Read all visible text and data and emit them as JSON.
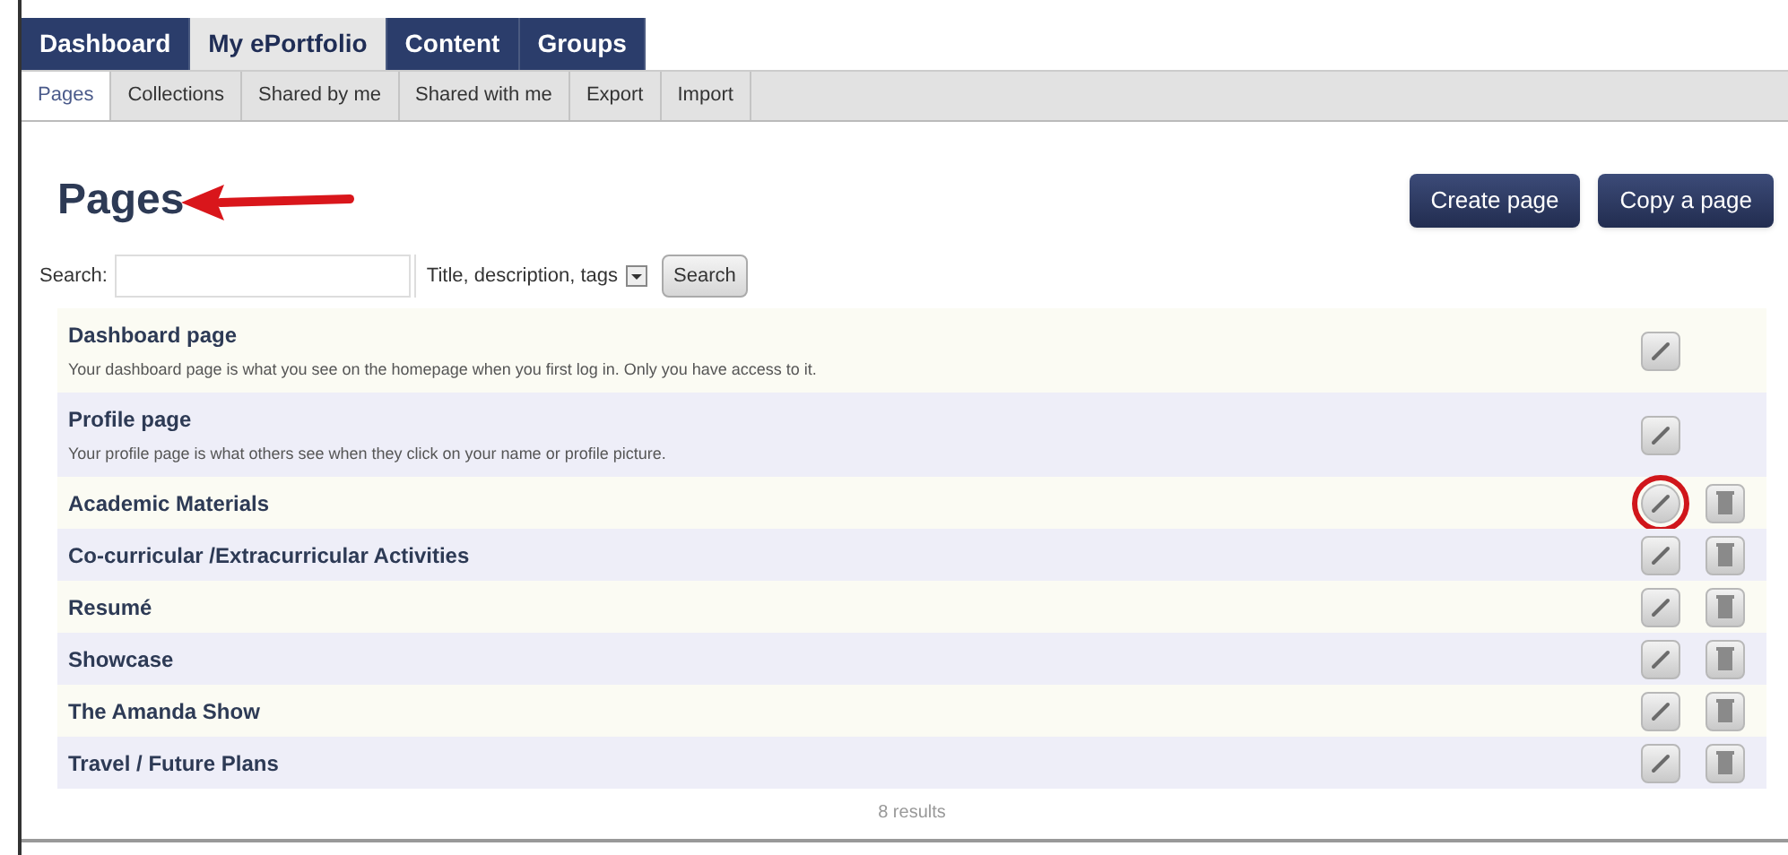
{
  "main_tabs": [
    {
      "label": "Dashboard",
      "selected": false
    },
    {
      "label": "My ePortfolio",
      "selected": true
    },
    {
      "label": "Content",
      "selected": false
    },
    {
      "label": "Groups",
      "selected": false
    }
  ],
  "sub_tabs": [
    {
      "label": "Pages",
      "selected": true
    },
    {
      "label": "Collections",
      "selected": false
    },
    {
      "label": "Shared by me",
      "selected": false
    },
    {
      "label": "Shared with me",
      "selected": false
    },
    {
      "label": "Export",
      "selected": false
    },
    {
      "label": "Import",
      "selected": false
    }
  ],
  "heading": "Pages",
  "buttons": [
    "Create page",
    "Copy a page"
  ],
  "search": {
    "label": "Search:",
    "scope": "Title, description, tags",
    "button": "Search"
  },
  "pages": [
    {
      "kind": "system",
      "title": "Dashboard page",
      "description": "Your dashboard page is what you see on the homepage when you first log in. Only you have access to it.",
      "circled": false
    },
    {
      "kind": "system",
      "title": "Profile page",
      "description": "Your profile page is what others see when they click on your name or profile picture.",
      "circled": false
    },
    {
      "kind": "user",
      "title": "Academic Materials",
      "circled": true
    },
    {
      "kind": "user",
      "title": "Co-curricular /Extracurricular Activities",
      "circled": false
    },
    {
      "kind": "user",
      "title": "Resumé",
      "circled": false
    },
    {
      "kind": "user",
      "title": "Showcase",
      "circled": false
    },
    {
      "kind": "user",
      "title": "The Amanda Show",
      "circled": false
    },
    {
      "kind": "user",
      "title": "Travel / Future Plans",
      "circled": false
    }
  ],
  "results": "8 results"
}
